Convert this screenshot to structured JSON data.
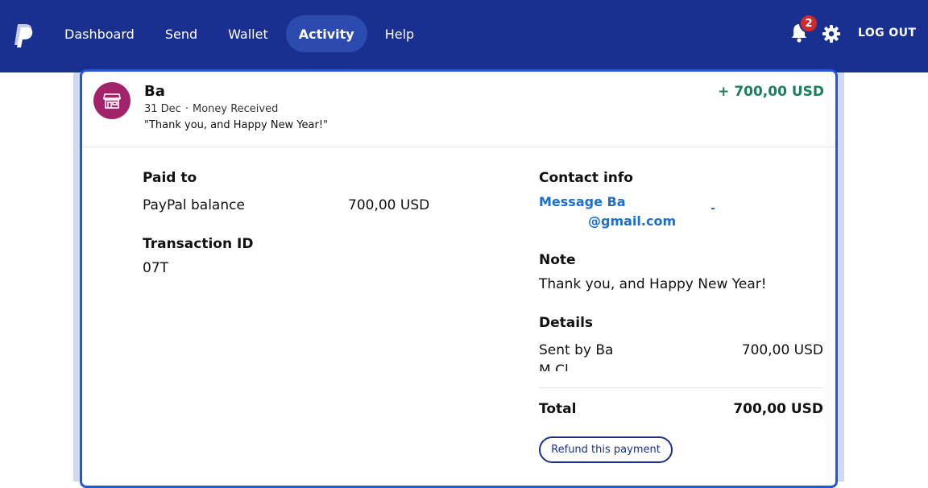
{
  "topbar": {
    "logo_icon": "paypal-logo",
    "nav": [
      {
        "label": "Dashboard",
        "active": false
      },
      {
        "label": "Send",
        "active": false
      },
      {
        "label": "Wallet",
        "active": false
      },
      {
        "label": "Activity",
        "active": true
      },
      {
        "label": "Help",
        "active": false
      }
    ],
    "notifications_count": "2",
    "logout_label": "LOG OUT",
    "colors": {
      "bar": "#1a3090",
      "active_tab": "#2c4bae",
      "badge": "#d02b2b"
    }
  },
  "transaction": {
    "sender_name": "Ba",
    "date": "31 Dec",
    "type": "Money Received",
    "message_quote": "\"Thank you, and Happy New Year!\"",
    "amount": "+ 700,00 USD",
    "avatar_icon": "store-icon",
    "avatar_color": "#a3236a",
    "amount_color": "#1a7f5a"
  },
  "details": {
    "paid_to_label": "Paid to",
    "paid_to_account": "PayPal balance",
    "paid_to_amount": "700,00 USD",
    "transaction_id_label": "Transaction ID",
    "transaction_id": "07T",
    "contact_label": "Contact info",
    "message_link": "Message Ba",
    "email": "@gmail.com",
    "note_label": "Note",
    "note_text": "Thank you, and Happy New Year!",
    "details_label": "Details",
    "sent_by": "Sent by Ba",
    "sent_by_line2": "M Cl",
    "sent_amount": "700,00 USD",
    "total_label": "Total",
    "total_amount": "700,00 USD",
    "refund_label": "Refund this payment"
  }
}
